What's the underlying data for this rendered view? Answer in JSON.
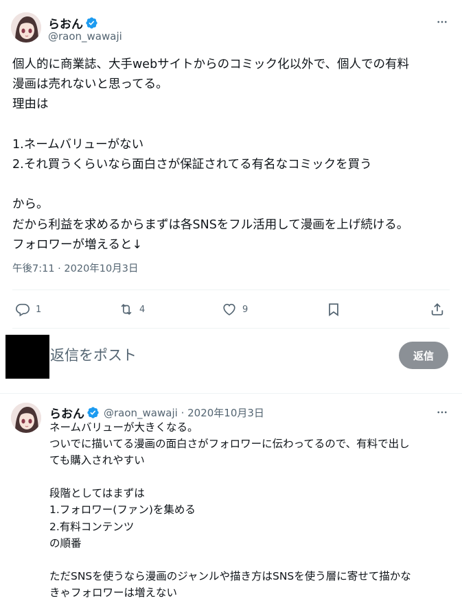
{
  "main_tweet": {
    "display_name": "らおん",
    "handle": "@raon_wawaji",
    "text": "個人的に商業誌、大手webサイトからのコミック化以外で、個人での有料\n漫画は売れないと思ってる。\n理由は\n\n1.ネームバリューがない\n2.それ買うくらいなら面白さが保証されてる有名なコミックを買う\n\nから。\nだから利益を求めるからまずは各SNSをフル活用して漫画を上げ続ける。\nフォロワーが増えると↓",
    "timestamp": "午後7:11 · 2020年10月3日",
    "actions": {
      "replies": "1",
      "retweets": "4",
      "likes": "9"
    }
  },
  "reply_compose": {
    "placeholder": "返信をポスト",
    "button_label": "返信"
  },
  "reply_tweet": {
    "display_name": "らおん",
    "handle": "@raon_wawaji · 2020年10月3日",
    "text": "ネームバリューが大きくなる。\nついでに描いてる漫画の面白さがフォロワーに伝わってるので、有料で出し\nても購入されやすい\n\n段階としてはまずは\n1.フォロワー(ファン)を集める\n2.有料コンテンツ\nの順番\n\nただSNSを使うなら漫画のジャンルや描き方はSNSを使う層に寄せて描かな\nきゃフォロワーは増えない"
  },
  "colors": {
    "text": "#0f1419",
    "secondary": "#536471",
    "verified": "#1d9bf0",
    "reply_button": "#8b9096",
    "divider": "#eff3f4"
  }
}
